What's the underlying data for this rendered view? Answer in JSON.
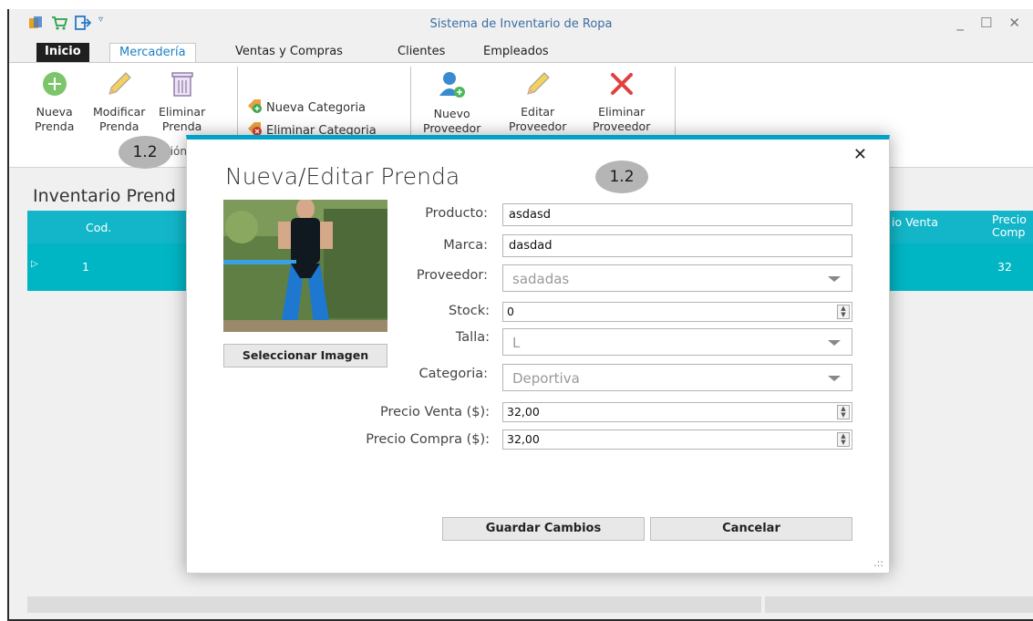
{
  "window": {
    "title": "Sistema de Inventario de Ropa",
    "controls": [
      "_",
      "☐",
      "✕"
    ]
  },
  "tabs": [
    "Inicio",
    "Mercadería",
    "Ventas y Compras",
    "Clientes",
    "Empleados"
  ],
  "ribbon": {
    "nueva_prenda": [
      "Nueva",
      "Prenda"
    ],
    "modificar_prenda": [
      "Modificar",
      "Prenda"
    ],
    "eliminar_prenda": [
      "Eliminar",
      "Prenda"
    ],
    "nueva_categoria": "Nueva Categoria",
    "eliminar_categoria": "Eliminar Categoria",
    "nuevo_proveedor": [
      "Nuevo",
      "Proveedor"
    ],
    "editar_proveedor": [
      "Editar",
      "Proveedor"
    ],
    "eliminar_proveedor": [
      "Eliminar",
      "Proveedor"
    ],
    "group_label_partial": "tión"
  },
  "badges": {
    "ribbon": "1.2",
    "dialog": "1.2"
  },
  "main": {
    "title": "Inventario Prend",
    "grid_headers": {
      "cod": "Cod.",
      "precio_venta": "io Venta",
      "precio_compra": [
        "Precio",
        "Comp"
      ]
    },
    "row": {
      "cod": "1",
      "precio_compra": "32"
    }
  },
  "dialog": {
    "title": "Nueva/Editar Prenda",
    "close": "✕",
    "select_image": "Seleccionar Imagen",
    "labels": {
      "producto": "Producto:",
      "marca": "Marca:",
      "proveedor": "Proveedor:",
      "stock": "Stock:",
      "talla": "Talla:",
      "categoria": "Categoria:",
      "precio_venta": "Precio Venta ($):",
      "precio_compra": "Precio Compra ($):"
    },
    "values": {
      "producto": "asdasd",
      "marca": "dasdad",
      "proveedor": "sadadas",
      "stock": "0",
      "talla": "L",
      "categoria": "Deportiva",
      "precio_venta": "32,00",
      "precio_compra": "32,00"
    },
    "save": "Guardar Cambios",
    "cancel": "Cancelar"
  },
  "colors": {
    "accent": "#00a2c8",
    "grid": "#00b6c4",
    "tab_active_text": "#1c7fc4"
  }
}
